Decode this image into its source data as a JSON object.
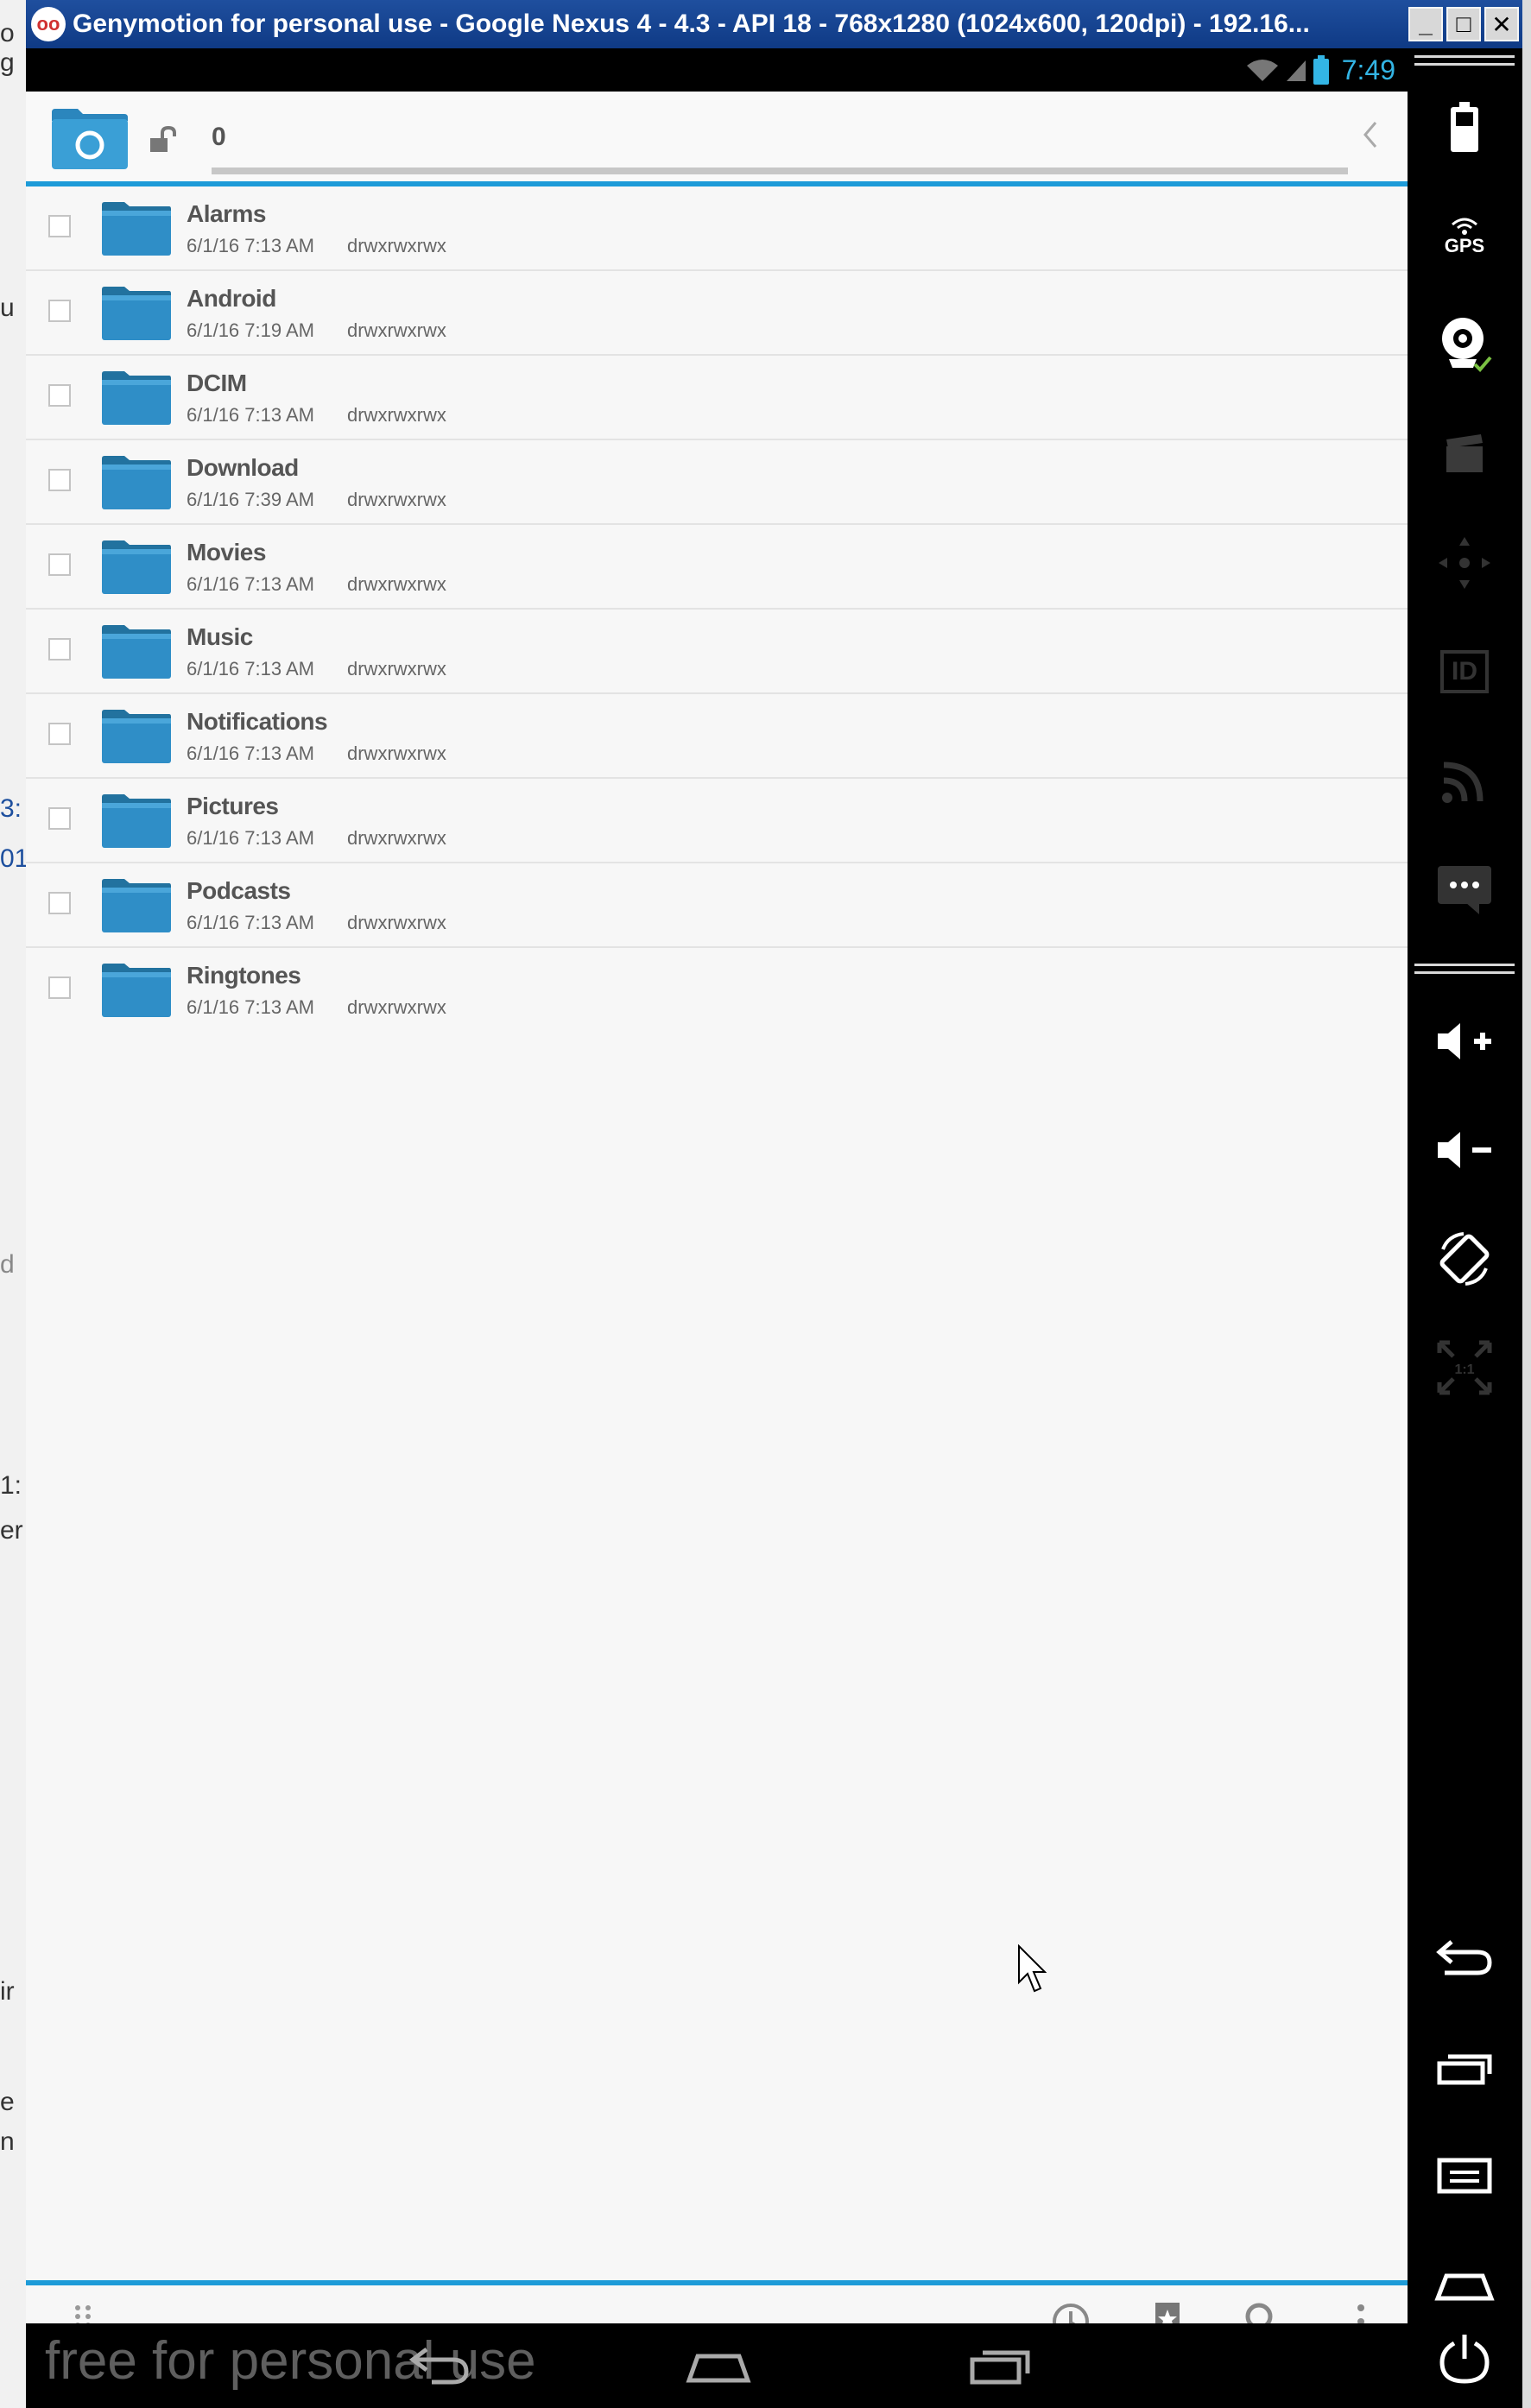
{
  "window": {
    "title": "Genymotion for personal use - Google Nexus 4 - 4.3 - API 18 - 768x1280 (1024x600, 120dpi) - 192.16...",
    "controls": {
      "minimize": "_",
      "maximize": "□",
      "close": "✕"
    }
  },
  "background_fragments": [
    "o g",
    "u",
    "3:",
    "01",
    "d",
    "1:",
    "er",
    "ir",
    "e",
    "n"
  ],
  "status_bar": {
    "time": "7:49",
    "icons": [
      "wifi-icon",
      "signal-icon",
      "battery-icon"
    ]
  },
  "header": {
    "path": "0",
    "home_icon": "home-folder-icon",
    "lock_icon": "unlock-icon",
    "back_icon": "chevron-left-icon"
  },
  "files": [
    {
      "name": "Alarms",
      "date": "6/1/16 7:13 AM",
      "perm": "drwxrwxrwx"
    },
    {
      "name": "Android",
      "date": "6/1/16 7:19 AM",
      "perm": "drwxrwxrwx"
    },
    {
      "name": "DCIM",
      "date": "6/1/16 7:13 AM",
      "perm": "drwxrwxrwx"
    },
    {
      "name": "Download",
      "date": "6/1/16 7:39 AM",
      "perm": "drwxrwxrwx"
    },
    {
      "name": "Movies",
      "date": "6/1/16 7:13 AM",
      "perm": "drwxrwxrwx"
    },
    {
      "name": "Music",
      "date": "6/1/16 7:13 AM",
      "perm": "drwxrwxrwx"
    },
    {
      "name": "Notifications",
      "date": "6/1/16 7:13 AM",
      "perm": "drwxrwxrwx"
    },
    {
      "name": "Pictures",
      "date": "6/1/16 7:13 AM",
      "perm": "drwxrwxrwx"
    },
    {
      "name": "Podcasts",
      "date": "6/1/16 7:13 AM",
      "perm": "drwxrwxrwx"
    },
    {
      "name": "Ringtones",
      "date": "6/1/16 7:13 AM",
      "perm": "drwxrwxrwx"
    }
  ],
  "bottom_toolbar": {
    "icons": [
      "drag-handle-icon",
      "history-icon",
      "bookmark-icon",
      "search-icon",
      "overflow-menu-icon"
    ]
  },
  "nav_bar": {
    "watermark": "free for personal use",
    "icons": [
      "back-icon",
      "home-icon",
      "recent-apps-icon"
    ]
  },
  "side_panel": {
    "icons": [
      "battery-icon",
      "gps-icon",
      "webcam-icon",
      "screencast-icon",
      "move-icon",
      "device-id-icon",
      "rss-icon",
      "sms-icon",
      "volume-up-icon",
      "volume-down-icon",
      "rotate-icon",
      "pixel-perfect-icon",
      "back-icon",
      "recent-apps-icon",
      "menu-icon",
      "home-icon",
      "power-icon"
    ],
    "gps_label": "GPS",
    "id_label": "ID",
    "scale_label": "1:1"
  },
  "colors": {
    "accent": "#1d9bd8",
    "folder": "#2f8ec7",
    "status_accent": "#33b5e5",
    "title_bar": "#1f4f9e"
  }
}
